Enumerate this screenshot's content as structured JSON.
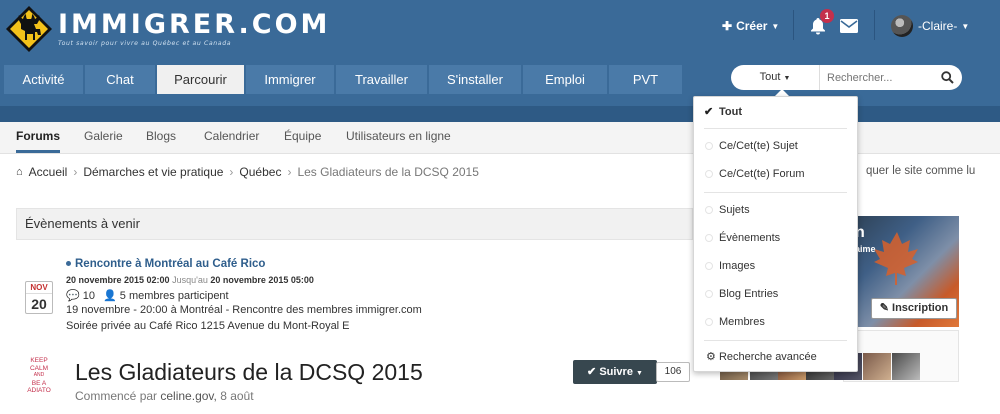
{
  "brand": {
    "logo_text": "IMMIGRER.COM",
    "tagline": "Tout savoir pour vivre au Québec et au Canada"
  },
  "header": {
    "create_label": "Créer",
    "notification_count": "1",
    "user_name": "-Claire-"
  },
  "nav": {
    "tabs": [
      {
        "label": "Activité"
      },
      {
        "label": "Chat"
      },
      {
        "label": "Parcourir"
      },
      {
        "label": "Immigrer"
      },
      {
        "label": "Travailler"
      },
      {
        "label": "S'installer"
      },
      {
        "label": "Emploi"
      },
      {
        "label": "PVT"
      }
    ],
    "active_index": 2
  },
  "search": {
    "scope_label": "Tout",
    "placeholder": "Rechercher..."
  },
  "subnav": {
    "items": [
      {
        "label": "Forums"
      },
      {
        "label": "Galerie"
      },
      {
        "label": "Blogs"
      },
      {
        "label": "Calendrier"
      },
      {
        "label": "Équipe"
      },
      {
        "label": "Utilisateurs en ligne"
      }
    ]
  },
  "breadcrumb": {
    "items": [
      "Accueil",
      "Démarches et vie pratique",
      "Québec",
      "Les Gladiateurs de la DCSQ 2015"
    ],
    "right_text": "quer le site comme lu"
  },
  "events": {
    "header": "Évènements à venir",
    "month": "NOV",
    "day": "20",
    "title": "Rencontre à Montréal au Café Rico",
    "start": "20 novembre 2015 02:00",
    "until_label": "Jusqu'au",
    "end": "20 novembre 2015 05:00",
    "comments": "10",
    "participants": "5 membres participent",
    "line1": "19 novembre - 20:00 à Montréal - Rencontre des membres immigrer.com",
    "line2": "Soirée privée au Café Rico 1215 Avenue du Mont-Royal E"
  },
  "topic": {
    "title": "Les Gladiateurs de la DCSQ 2015",
    "started_by": "Commencé par",
    "author": "celine.gov,",
    "date": "8 août",
    "follow_label": "Suivre",
    "follow_count": "106",
    "avatar_text": [
      "KEEP",
      "CALM",
      "AND",
      "BE A",
      "ADIATO"
    ]
  },
  "sidebar": {
    "promo_n": "n",
    "promo_aime": "aime",
    "signup_label": "Inscription"
  },
  "dropdown": {
    "items": [
      {
        "label": "Tout",
        "selected": true
      },
      {
        "label": "Ce/Cet(te) Sujet"
      },
      {
        "label": "Ce/Cet(te) Forum"
      },
      {
        "label": "Sujets"
      },
      {
        "label": "Évènements"
      },
      {
        "label": "Images"
      },
      {
        "label": "Blog Entries"
      },
      {
        "label": "Membres"
      }
    ],
    "advanced_label": "Recherche avancée"
  },
  "colors": {
    "header_blue": "#3a6a98",
    "nav_dark": "#2e5a85",
    "link_blue": "#2f5e8c",
    "badge_red": "#c4304c",
    "follow_dark": "#37474f"
  }
}
